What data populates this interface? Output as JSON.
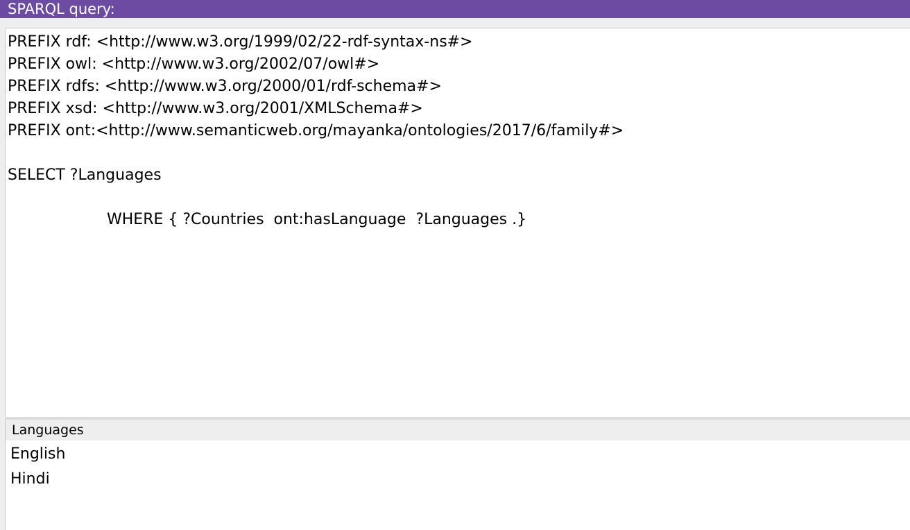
{
  "title_bar": {
    "label": "SPARQL query:"
  },
  "query_editor": {
    "lines": [
      "PREFIX rdf: <http://www.w3.org/1999/02/22-rdf-syntax-ns#>",
      "PREFIX owl: <http://www.w3.org/2002/07/owl#>",
      "PREFIX rdfs: <http://www.w3.org/2000/01/rdf-schema#>",
      "PREFIX xsd: <http://www.w3.org/2001/XMLSchema#>",
      "PREFIX ont:<http://www.semanticweb.org/mayanka/ontologies/2017/6/family#>",
      "",
      "SELECT ?Languages",
      "",
      "WHERE { ?Countries  ont:hasLanguage  ?Languages .}"
    ]
  },
  "results": {
    "columns": [
      "Languages"
    ],
    "rows": [
      [
        "English"
      ],
      [
        "Hindi"
      ]
    ]
  },
  "colors": {
    "title_bar_bg": "#6d4ba3",
    "title_bar_text": "#ffffff",
    "editor_bg": "#ffffff",
    "panel_bg": "#eeeeee"
  }
}
